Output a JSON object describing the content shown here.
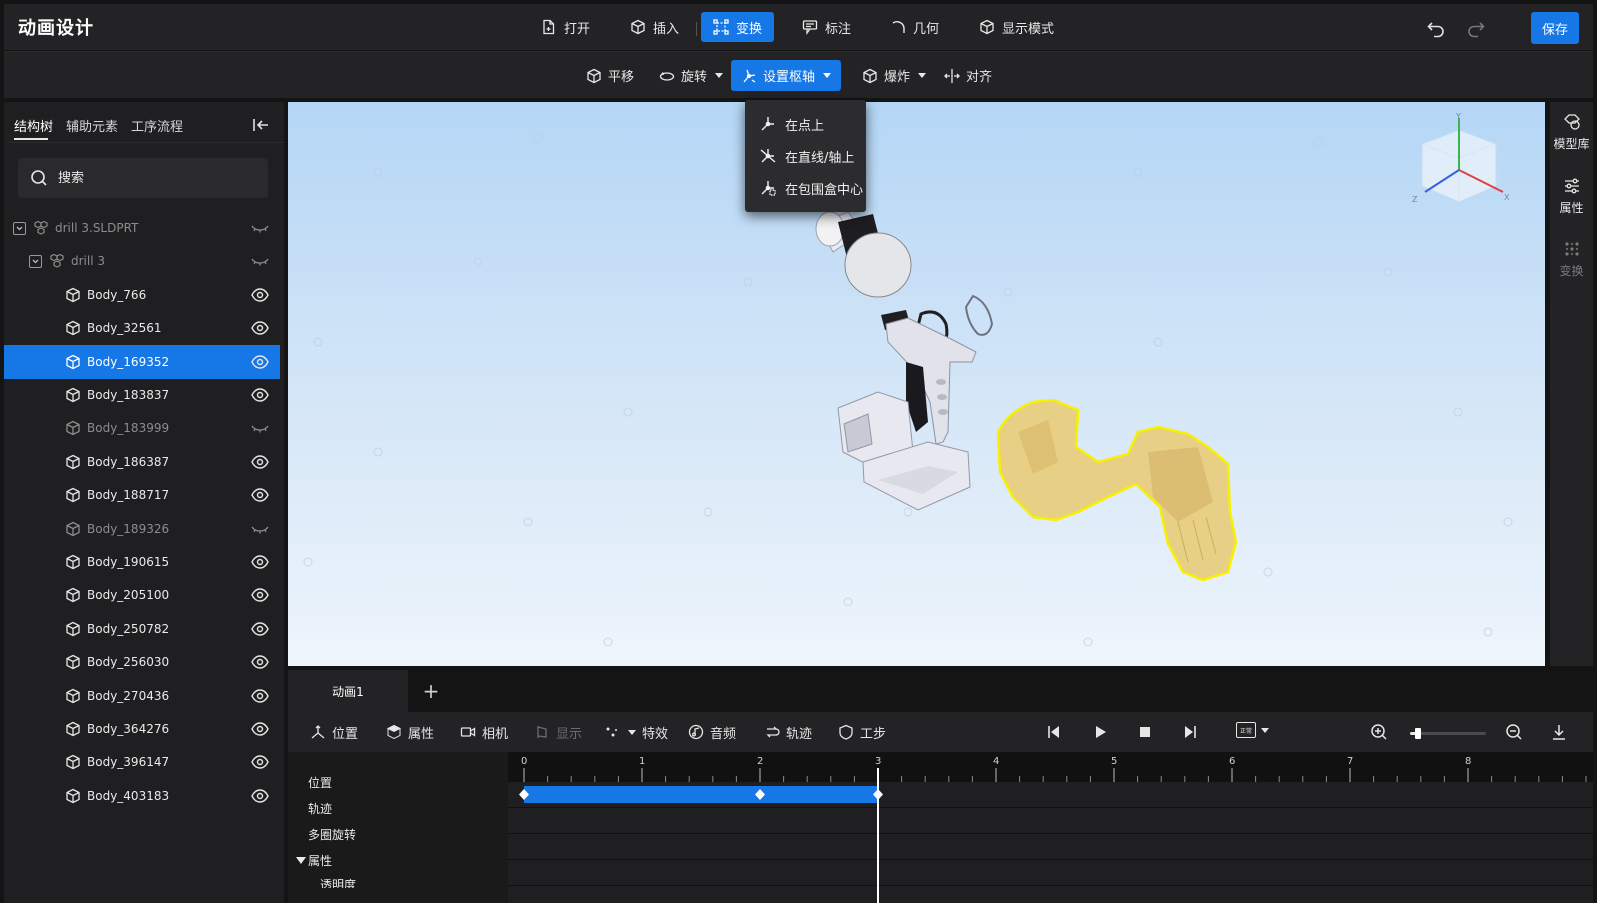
{
  "app": {
    "title": "动画设计",
    "save_label": "保存"
  },
  "top_menu": [
    {
      "label": "打开",
      "icon": "open-file-icon",
      "active": false
    },
    {
      "label": "插入",
      "icon": "insert-cube-icon",
      "active": false
    },
    {
      "label": "变换",
      "icon": "transform-icon",
      "active": true
    },
    {
      "label": "标注",
      "icon": "annotation-icon",
      "active": false
    },
    {
      "label": "几何",
      "icon": "geometry-icon",
      "active": false
    },
    {
      "label": "显示模式",
      "icon": "display-mode-icon",
      "active": false
    }
  ],
  "toolbar2": [
    {
      "label": "平移",
      "icon": "translate-icon",
      "dropdown": false,
      "active": false
    },
    {
      "label": "旋转",
      "icon": "rotate-icon",
      "dropdown": true,
      "active": false
    },
    {
      "label": "设置枢轴",
      "icon": "pivot-icon",
      "dropdown": true,
      "active": true
    },
    {
      "label": "爆炸",
      "icon": "explode-icon",
      "dropdown": true,
      "active": false
    },
    {
      "label": "对齐",
      "icon": "align-icon",
      "dropdown": false,
      "active": false
    }
  ],
  "pivot_menu": [
    {
      "label": "在点上",
      "icon": "pivot-point-icon"
    },
    {
      "label": "在直线/轴上",
      "icon": "pivot-axis-icon"
    },
    {
      "label": "在包围盒中心",
      "icon": "pivot-bbox-center-icon"
    }
  ],
  "left_panel": {
    "tabs": [
      "结构树",
      "辅助元素",
      "工序流程"
    ],
    "active_tab": "结构树",
    "search_placeholder": "搜索",
    "tree": [
      {
        "label": "drill 3.SLDPRT",
        "level": 0,
        "type": "assembly",
        "visible": false,
        "selected": false
      },
      {
        "label": "drill 3",
        "level": 1,
        "type": "assembly",
        "visible": false,
        "selected": false
      },
      {
        "label": "Body_766",
        "level": 2,
        "type": "body",
        "visible": true,
        "selected": false
      },
      {
        "label": "Body_32561",
        "level": 2,
        "type": "body",
        "visible": true,
        "selected": false
      },
      {
        "label": "Body_169352",
        "level": 2,
        "type": "body",
        "visible": true,
        "selected": true
      },
      {
        "label": "Body_183837",
        "level": 2,
        "type": "body",
        "visible": true,
        "selected": false
      },
      {
        "label": "Body_183999",
        "level": 2,
        "type": "body",
        "visible": false,
        "selected": false
      },
      {
        "label": "Body_186387",
        "level": 2,
        "type": "body",
        "visible": true,
        "selected": false
      },
      {
        "label": "Body_188717",
        "level": 2,
        "type": "body",
        "visible": true,
        "selected": false
      },
      {
        "label": "Body_189326",
        "level": 2,
        "type": "body",
        "visible": false,
        "selected": false
      },
      {
        "label": "Body_190615",
        "level": 2,
        "type": "body",
        "visible": true,
        "selected": false
      },
      {
        "label": "Body_205100",
        "level": 2,
        "type": "body",
        "visible": true,
        "selected": false
      },
      {
        "label": "Body_250782",
        "level": 2,
        "type": "body",
        "visible": true,
        "selected": false
      },
      {
        "label": "Body_256030",
        "level": 2,
        "type": "body",
        "visible": true,
        "selected": false
      },
      {
        "label": "Body_270436",
        "level": 2,
        "type": "body",
        "visible": true,
        "selected": false
      },
      {
        "label": "Body_364276",
        "level": 2,
        "type": "body",
        "visible": true,
        "selected": false
      },
      {
        "label": "Body_396147",
        "level": 2,
        "type": "body",
        "visible": true,
        "selected": false
      },
      {
        "label": "Body_403183",
        "level": 2,
        "type": "body",
        "visible": true,
        "selected": false
      }
    ]
  },
  "right_panel": [
    {
      "label": "模型库",
      "icon": "model-library-icon",
      "enabled": true
    },
    {
      "label": "属性",
      "icon": "properties-icon",
      "enabled": true
    },
    {
      "label": "变换",
      "icon": "transform-grid-icon",
      "enabled": false
    }
  ],
  "view_cube": {
    "axis_labels": [
      "Y",
      "Z",
      "X"
    ]
  },
  "animation": {
    "tab_label": "动画1",
    "add_tab": "+",
    "toolbar_left": [
      {
        "label": "位置",
        "icon": "position-icon",
        "enabled": true
      },
      {
        "label": "属性",
        "icon": "attribute-cube-icon",
        "enabled": true
      },
      {
        "label": "相机",
        "icon": "camera-icon",
        "enabled": true
      },
      {
        "label": "显示",
        "icon": "display-icon",
        "enabled": false
      },
      {
        "label": "特效",
        "icon": "effects-icon",
        "enabled": true
      },
      {
        "label": "音频",
        "icon": "audio-icon",
        "enabled": true
      },
      {
        "label": "轨迹",
        "icon": "trajectory-icon",
        "enabled": true
      },
      {
        "label": "工步",
        "icon": "step-icon",
        "enabled": true
      }
    ],
    "playback_icons": [
      "prev-frame-icon",
      "play-icon",
      "stop-icon",
      "next-frame-icon",
      "speed-icon"
    ],
    "speed_badge": "正常",
    "zoom_level": 0.1,
    "ruler_labels": [
      "0",
      "1",
      "2",
      "3",
      "4",
      "5",
      "6",
      "7",
      "8"
    ],
    "playhead_time": 3,
    "tracks": [
      "位置",
      "轨迹",
      "多圈旋转",
      "属性",
      "透明度"
    ],
    "keyframes": [
      0,
      2,
      3
    ],
    "bar_range": [
      0,
      3
    ],
    "accent": "#1677e6"
  }
}
